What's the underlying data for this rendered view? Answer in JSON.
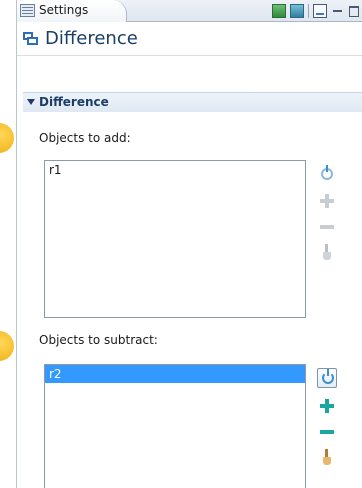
{
  "tab": {
    "label": "Settings"
  },
  "header": {
    "title": "Difference"
  },
  "section": {
    "title": "Difference"
  },
  "objects_to_add": {
    "label": "Objects to add:",
    "items": [
      "r1"
    ]
  },
  "objects_to_subtract": {
    "label": "Objects to subtract:",
    "items": [
      "r2"
    ]
  },
  "icons": {
    "tab": "settings-icon",
    "title": "difference-icon",
    "activate": "activate-selection-icon",
    "add": "add-icon",
    "remove": "remove-icon",
    "clear": "clear-selection-icon"
  },
  "colors": {
    "accent": "#3399ff",
    "title": "#1c3d66",
    "callout": "#f3b81f"
  }
}
